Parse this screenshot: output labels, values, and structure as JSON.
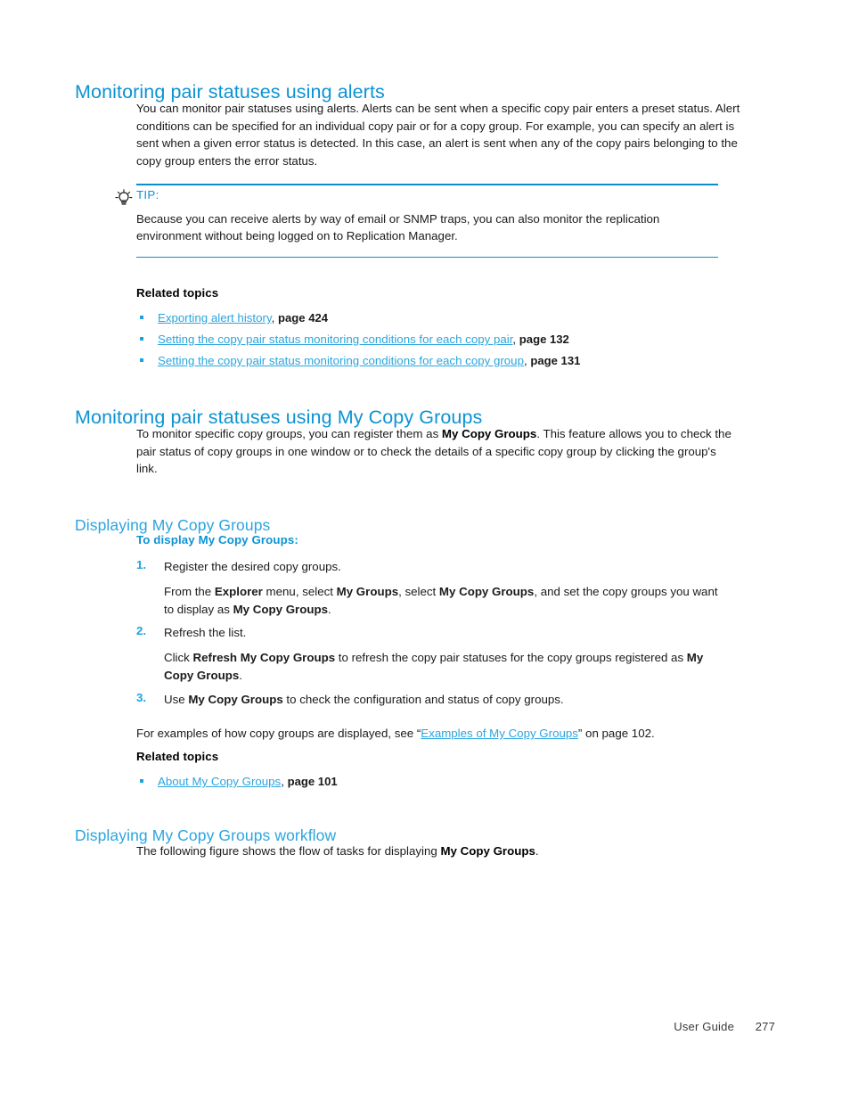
{
  "page": {
    "footer_label": "User Guide",
    "footer_page": "277"
  },
  "colors": {
    "heading_blue": "#0c93d4",
    "subheading_blue": "#2ba5de",
    "link_blue": "#2ba5de",
    "rule_blue": "#0c8fc9",
    "body_text": "#1a1a1a"
  },
  "section_alerts": {
    "heading": "Monitoring pair statuses using alerts",
    "paragraph": "You can monitor pair statuses using alerts. Alerts can be sent when a specific copy pair enters a preset status. Alert conditions can be specified for an individual copy pair or for a copy group. For example, you can specify an alert is sent when a given error status is detected. In this case, an alert is sent when any of the copy pairs belonging to the copy group enters the error status.",
    "tip": {
      "icon": "lightbulb-tip-icon",
      "label": "TIP:",
      "body": "Because you can receive alerts by way of email or SNMP traps, you can also monitor the replication environment without being logged on to Replication Manager."
    },
    "related_topics": {
      "title": "Related topics",
      "items": [
        {
          "link": "Exporting alert history",
          "sep": ", ",
          "page": "page 424"
        },
        {
          "link": "Setting the copy pair status monitoring conditions for each copy pair",
          "sep": ", ",
          "page": "page 132"
        },
        {
          "link": "Setting the copy pair status monitoring conditions for each copy group",
          "sep": ", ",
          "page": "page 131"
        }
      ]
    }
  },
  "section_mycopygroups": {
    "heading": "Monitoring pair statuses using My Copy Groups",
    "paragraph_parts": {
      "a": "To monitor specific copy groups, you can register them as ",
      "b1": "My Copy Groups",
      "c": ". This feature allows you to check the pair status of copy groups in one window or to check the details of a specific copy group by clicking the group's link."
    }
  },
  "section_displaying": {
    "heading": "Displaying My Copy Groups",
    "procedure_title": "To display My Copy Groups:",
    "steps": [
      {
        "num": "1.",
        "text": "Register the desired copy groups.",
        "detail_parts": {
          "a": "From the ",
          "b1": "Explorer",
          "c": " menu, select ",
          "b2": "My Groups",
          "d": ", select ",
          "b3": "My Copy Groups",
          "e": ", and set the copy groups you want to display as ",
          "b4": "My Copy Groups",
          "f": "."
        }
      },
      {
        "num": "2.",
        "text": "Refresh the list.",
        "detail_parts": {
          "a": "Click ",
          "b1": "Refresh My Copy Groups",
          "c": " to refresh the copy pair statuses for the copy groups registered as ",
          "b2": "My Copy Groups",
          "d": "."
        }
      },
      {
        "num": "3.",
        "text_parts": {
          "a": "Use ",
          "b1": "My Copy Groups",
          "c": " to check the configuration and status of copy groups."
        }
      }
    ],
    "examples_line": {
      "a": "For examples of how copy groups are displayed, see “",
      "link": "Examples of My Copy Groups",
      "c": "” on page 102."
    },
    "related_topics": {
      "title": "Related topics",
      "items": [
        {
          "link": "About My Copy Groups",
          "sep": ", ",
          "page": "page 101"
        }
      ]
    }
  },
  "section_workflow": {
    "heading": "Displaying My Copy Groups workflow",
    "paragraph_parts": {
      "a": "The following figure shows the flow of tasks for displaying ",
      "b1": "My Copy Groups",
      "c": "."
    }
  }
}
